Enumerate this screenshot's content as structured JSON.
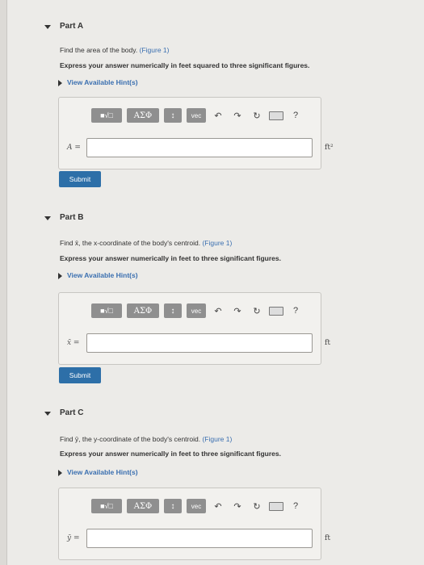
{
  "parts": [
    {
      "title": "Part A",
      "question_prefix": "Find the area of the body.",
      "figure_link": "(Figure 1)",
      "instruction": "Express your answer numerically in feet squared to three significant figures.",
      "hint_label": "View Available Hint(s)",
      "variable": "A =",
      "input_value": "",
      "unit": "ft²",
      "submit_label": "Submit"
    },
    {
      "title": "Part B",
      "question_prefix": "Find x̄, the x-coordinate of the body's centroid.",
      "figure_link": "(Figure 1)",
      "instruction": "Express your answer numerically in feet to three significant figures.",
      "hint_label": "View Available Hint(s)",
      "variable": "x̄ =",
      "input_value": "",
      "unit": "ft",
      "submit_label": "Submit"
    },
    {
      "title": "Part C",
      "question_prefix": "Find ȳ, the y-coordinate of the body's centroid.",
      "figure_link": "(Figure 1)",
      "instruction": "Express your answer numerically in feet to three significant figures.",
      "hint_label": "View Available Hint(s)",
      "variable": "ȳ =",
      "input_value": "",
      "unit": "ft"
    }
  ],
  "toolbar": {
    "templates_label": "■√□",
    "greek_label": "ΑΣΦ",
    "arrows_label": "↕",
    "vec_label": "vec",
    "help_label": "?",
    "icons": [
      "undo-icon",
      "redo-icon",
      "reset-icon",
      "keyboard-icon",
      "help-icon"
    ]
  }
}
